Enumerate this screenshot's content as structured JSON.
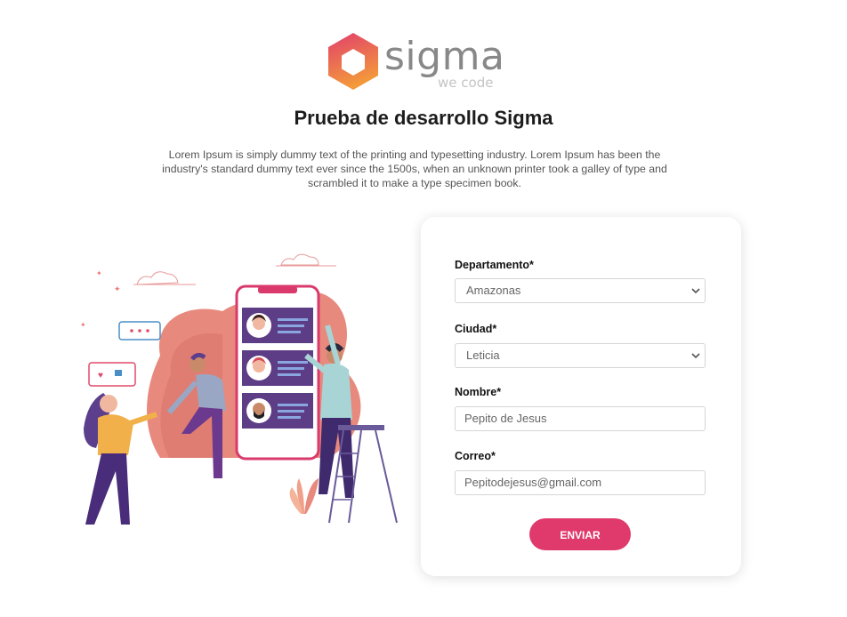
{
  "brand": {
    "name": "sigma",
    "tagline": "we code",
    "colors": {
      "logo_start": "#e23f6c",
      "logo_end": "#f39a3a",
      "accent": "#df3a6b"
    }
  },
  "header": {
    "title": "Prueba de desarrollo Sigma",
    "description": "Lorem Ipsum is simply dummy text of the printing and typesetting industry. Lorem Ipsum has been the industry's standard dummy text ever since the 1500s, when an unknown printer took a galley of type and scrambled it to make a type specimen book."
  },
  "form": {
    "departamento": {
      "label": "Departamento*",
      "value": "Amazonas"
    },
    "ciudad": {
      "label": "Ciudad*",
      "value": "Leticia"
    },
    "nombre": {
      "label": "Nombre*",
      "value": "Pepito de Jesus"
    },
    "correo": {
      "label": "Correo*",
      "value": "Pepitodejesus@gmail.com"
    },
    "submit_label": "ENVIAR"
  },
  "icons": {
    "select_arrow": "chevron-down-icon",
    "logo": "hexagon-logo-icon"
  }
}
